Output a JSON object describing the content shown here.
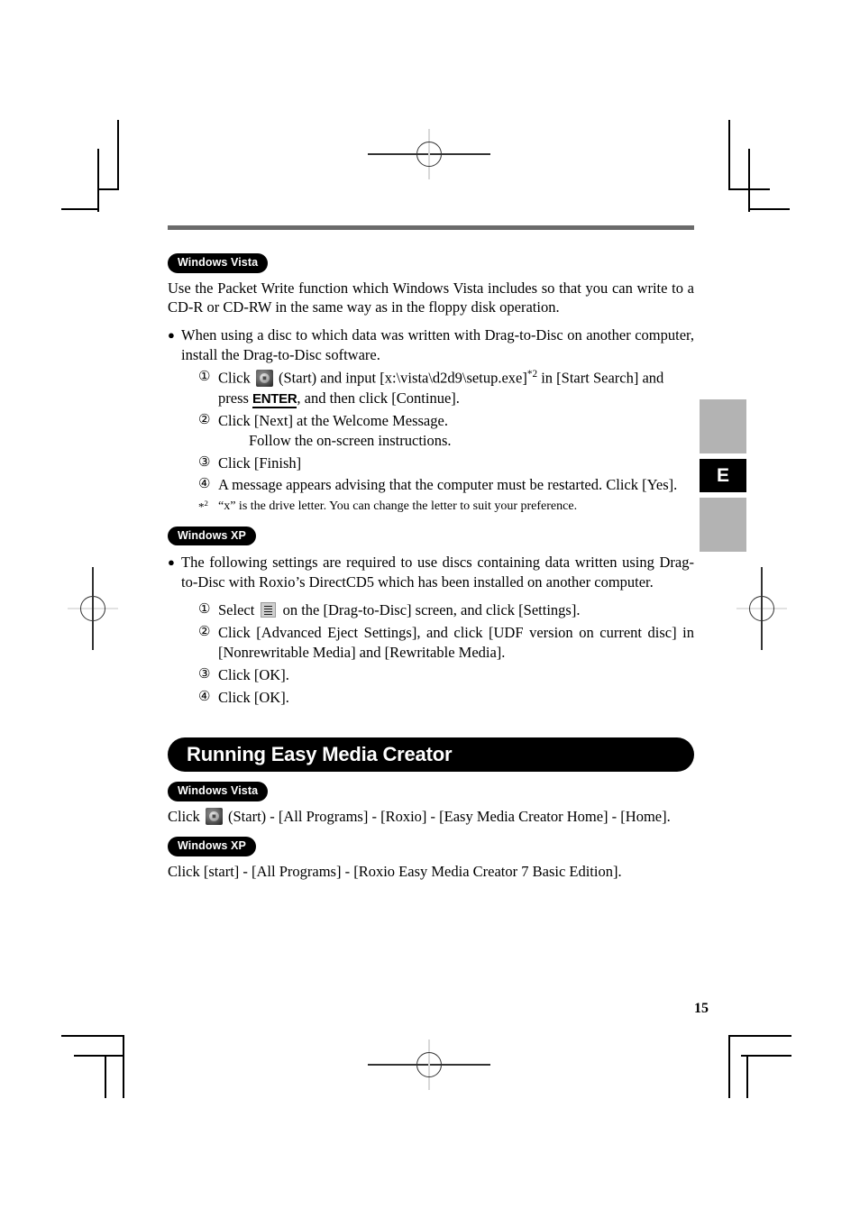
{
  "page": {
    "number": "15",
    "thumb_tab_letter": "E",
    "rule_color": "#6b6b6b",
    "accent_color": "#000000",
    "tab_gray_color": "#b3b3b3"
  },
  "section_vista": {
    "os_tag": "Windows Vista",
    "intro": "Use the Packet Write function which Windows Vista includes so that you can write to a CD-R or CD-RW in the same way as in the floppy disk operation.",
    "bullet": "When using a disc to which data was written with Drag-to-Disc on another computer, install the Drag-to-Disc software.",
    "steps": [
      {
        "num": "①",
        "text_before_icon": "Click ",
        "icon": "windows-start-icon",
        "text_after_icon": " (Start) and input [x:\\vista\\d2d9\\setup.exe]",
        "superscript": "*2",
        "text_mid": " in [Start Search] and press ",
        "key": "ENTER",
        "text_end": ", and then click [Continue]."
      },
      {
        "num": "②",
        "text": "Click [Next] at the Welcome Message.",
        "continuation": "Follow the on-screen instructions."
      },
      {
        "num": "③",
        "text": "Click [Finish]"
      },
      {
        "num": "④",
        "text": "A message appears advising that the computer must be restarted. Click [Yes]."
      }
    ],
    "footnote": {
      "mark": "*",
      "mark_sup": "2",
      "text": "“x” is the drive letter. You can change the letter to suit your preference."
    }
  },
  "section_xp": {
    "os_tag": "Windows XP",
    "bullet": "The following settings are required to use discs containing data written using Drag-to-Disc with Roxio’s DirectCD5 which has been installed on another computer.",
    "steps": [
      {
        "num": "①",
        "text_before_icon": "Select ",
        "icon": "drag-to-disc-menu-icon",
        "text_after_icon": " on the [Drag-to-Disc] screen, and click [Settings]."
      },
      {
        "num": "②",
        "text": "Click [Advanced Eject Settings], and click [UDF version on current disc] in [Nonrewritable Media] and [Rewritable Media]."
      },
      {
        "num": "③",
        "text": "Click [OK]."
      },
      {
        "num": "④",
        "text": "Click [OK]."
      }
    ]
  },
  "section_running": {
    "title": "Running Easy Media Creator",
    "vista": {
      "os_tag": "Windows Vista",
      "text_before_icon": "Click ",
      "icon": "windows-start-icon",
      "text_after_icon": " (Start) - [All Programs] - [Roxio] - [Easy Media Creator Home] - [Home]."
    },
    "xp": {
      "os_tag": "Windows XP",
      "text": "Click [start] - [All Programs] - [Roxio Easy Media Creator 7 Basic Edition]."
    }
  }
}
